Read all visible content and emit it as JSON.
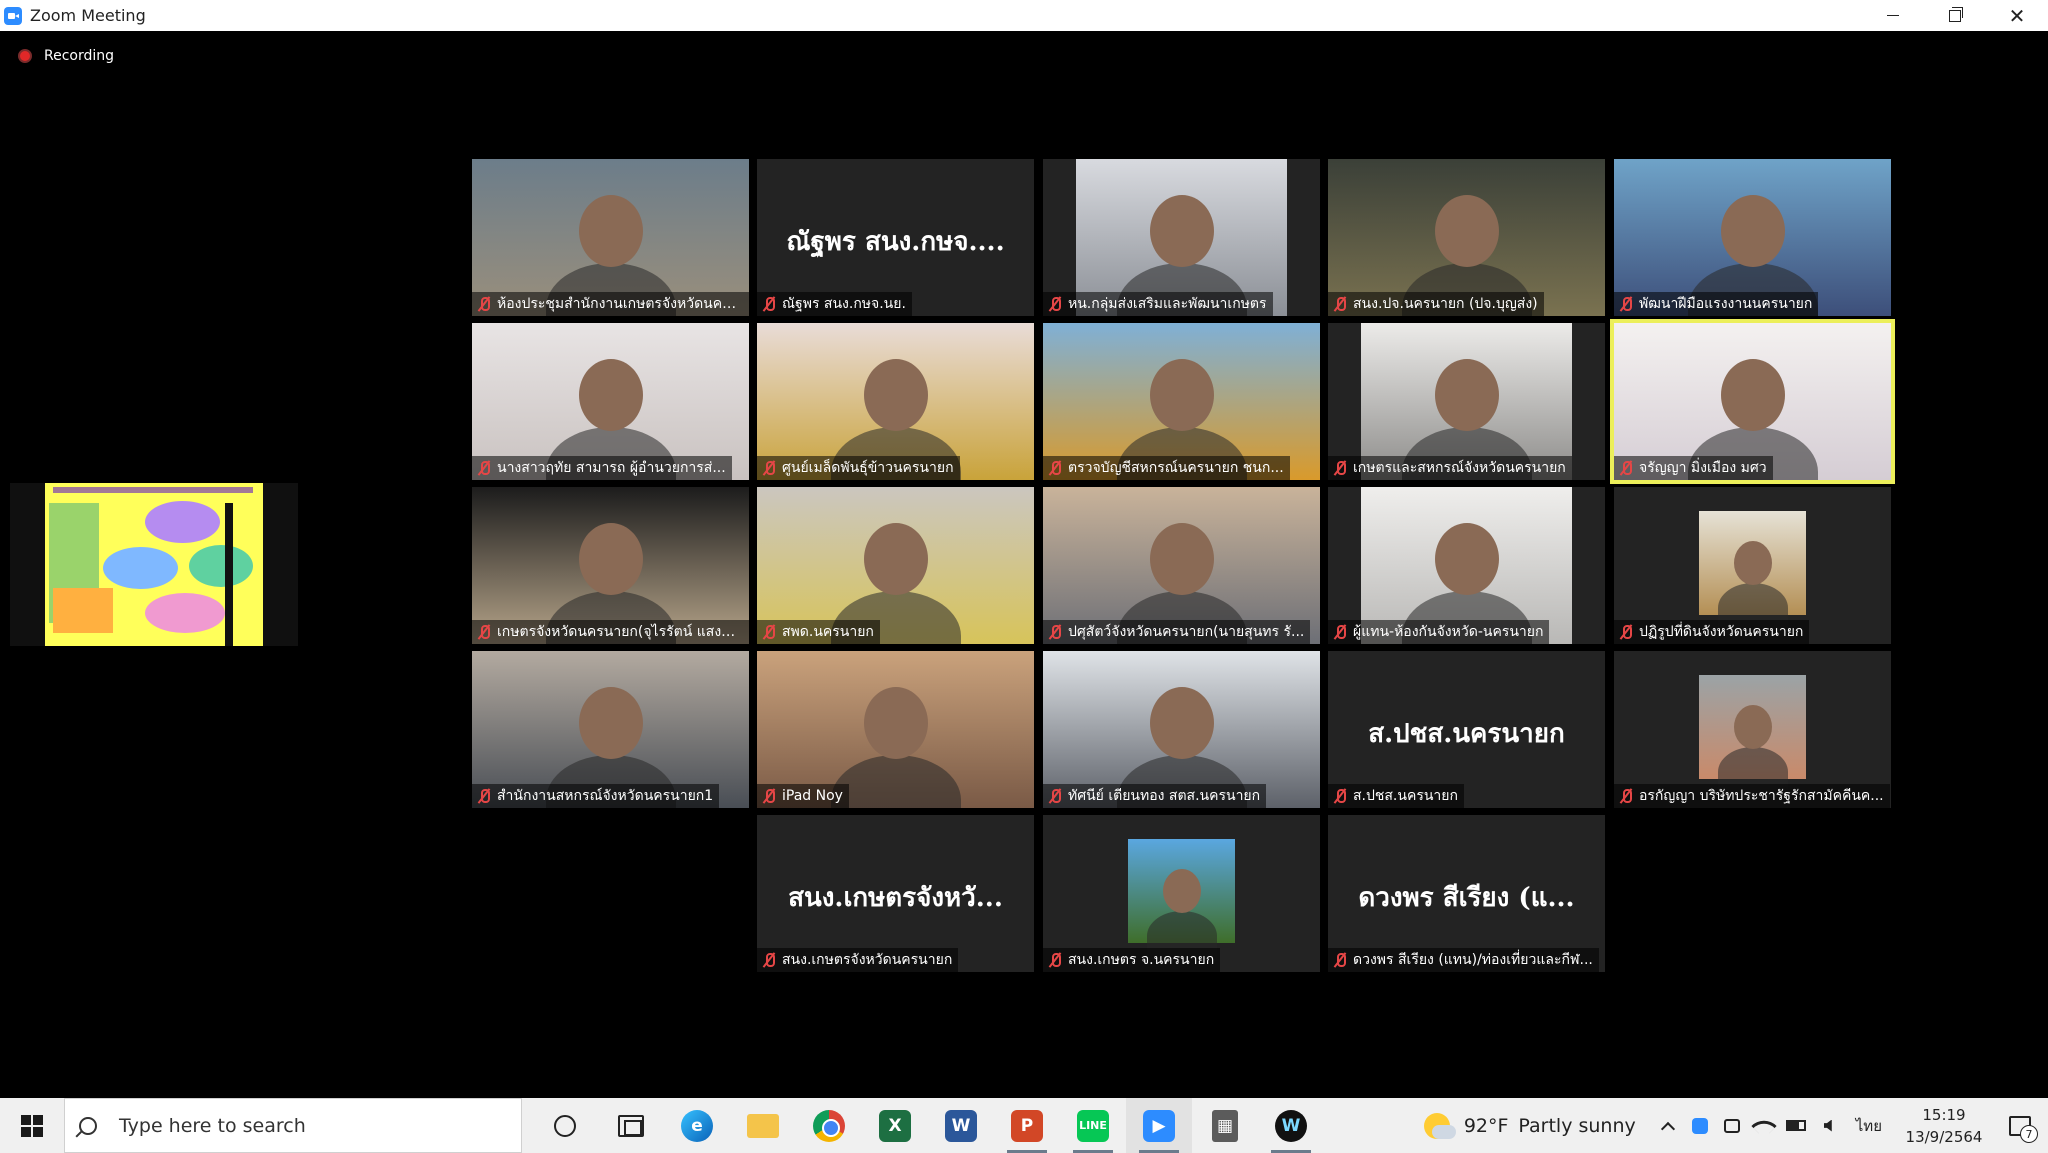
{
  "window": {
    "title": "Zoom Meeting"
  },
  "recording": {
    "label": "Recording"
  },
  "gallery": [
    {
      "label": "ห้องประชุมสำนักงานเกษตรจังหวัดนครนา...",
      "kind": "video",
      "bg": [
        "#6c7d8a",
        "#9a8f7c"
      ],
      "active": false
    },
    {
      "label": "ณัฐพร สนง.กษจ.นย.",
      "kind": "name",
      "name_text": "ณัฐพร สนง.กษจ....",
      "active": false
    },
    {
      "label": "หน.กลุ่มส่งเสริมและพัฒนาเกษตร",
      "kind": "video-inset",
      "bg": [
        "#d8dadf",
        "#8b8f96"
      ],
      "active": false
    },
    {
      "label": "สนง.ปจ.นครนายก (ปจ.บุญส่ง)",
      "kind": "video",
      "bg": [
        "#3b4038",
        "#7a7250"
      ],
      "active": false
    },
    {
      "label": "พัฒนาฝีมือแรงงานนครนายก",
      "kind": "video",
      "bg": [
        "#6fa3c8",
        "#3d4f7a"
      ],
      "active": false
    },
    {
      "label": "นางสาวฤทัย สามารถ ผู้อำนวยการส่...",
      "kind": "video",
      "bg": [
        "#e8e4e4",
        "#c9c2c0"
      ],
      "active": false
    },
    {
      "label": "ศูนย์เมล็ดพันธุ์ข้าวนครนายก",
      "kind": "video",
      "bg": [
        "#e9dcd8",
        "#c9a33a"
      ],
      "active": false
    },
    {
      "label": "ตรวจบัญชีสหกรณ์นครนายก ชนก...",
      "kind": "video",
      "bg": [
        "#7fb0d6",
        "#d99a2b"
      ],
      "active": false
    },
    {
      "label": "เกษตรและสหกรณ์จังหวัดนครนายก",
      "kind": "video-inset",
      "bg": [
        "#ecebe9",
        "#8d8c8a"
      ],
      "active": false
    },
    {
      "label": "จรัญญา มิ่งเมือง มศว",
      "kind": "video",
      "bg": [
        "#f4f1f0",
        "#d5cdd4"
      ],
      "active": true
    },
    {
      "label": "เกษตรจังหวัดนครนายก(จุไรรัตน์ แสงสวัส...",
      "kind": "video",
      "bg": [
        "#1c1c1c",
        "#b7a58a"
      ],
      "active": false
    },
    {
      "label": "สพด.นครนายก",
      "kind": "video",
      "bg": [
        "#cbc6bf",
        "#d7c45a"
      ],
      "active": false
    },
    {
      "label": "ปศุสัตว์จังหวัดนครนายก(นายสุนทร รั...",
      "kind": "video",
      "bg": [
        "#c9b39a",
        "#6d6f76"
      ],
      "active": false
    },
    {
      "label": "ผู้แทน-ห้องกันจังหวัด-นครนายก",
      "kind": "video-inset",
      "bg": [
        "#efeeec",
        "#b9b8b6"
      ],
      "active": false
    },
    {
      "label": "ปฏิรูปที่ดินจังหวัดนครนายก",
      "kind": "video-small",
      "bg": [
        "#e6e2d6",
        "#b48f54"
      ],
      "active": false
    },
    {
      "label": "สำนักงานสหกรณ์จังหวัดนครนายก1",
      "kind": "video",
      "bg": [
        "#b3aaa0",
        "#494e55"
      ],
      "active": false
    },
    {
      "label": "iPad Noy",
      "kind": "video",
      "bg": [
        "#caa27c",
        "#7a5a46"
      ],
      "active": false
    },
    {
      "label": "ทัศนีย์ เตียนทอง สตส.นครนายก",
      "kind": "video",
      "bg": [
        "#dfe3e7",
        "#5d6169"
      ],
      "active": false
    },
    {
      "label": "ส.ปชส.นครนายก",
      "kind": "name",
      "name_text": "ส.ปชส.นครนายก",
      "active": false
    },
    {
      "label": "อรกัญญา บริษัทประชารัฐรักสามัคคีนค...",
      "kind": "video-small",
      "bg": [
        "#9ba3a6",
        "#c98a6a"
      ],
      "active": false
    },
    {
      "label": "สนง.เกษตรจังหวัดนครนายก",
      "kind": "name",
      "name_text": "สนง.เกษตรจังหวั...",
      "active": false
    },
    {
      "label": "สนง.เกษตร จ.นครนายก",
      "kind": "video-small",
      "bg": [
        "#5aa7e0",
        "#3f6e2a"
      ],
      "active": false
    },
    {
      "label": "ดวงพร สีเรียง (แทน)/ท่องเที่ยวและกีฬ...",
      "kind": "name",
      "name_text": "ดวงพร สีเรียง (แ...",
      "active": false
    }
  ],
  "taskbar": {
    "search_placeholder": "Type here to search",
    "apps": [
      {
        "icon": "cortana-icon",
        "glyph": "",
        "open": false
      },
      {
        "icon": "task-view-icon",
        "glyph": "",
        "open": false
      },
      {
        "icon": "edge-icon",
        "glyph": "e",
        "open": false
      },
      {
        "icon": "file-explorer-icon",
        "glyph": "",
        "open": false
      },
      {
        "icon": "chrome-icon",
        "glyph": "",
        "open": false
      },
      {
        "icon": "excel-icon",
        "glyph": "X",
        "open": false
      },
      {
        "icon": "word-icon",
        "glyph": "W",
        "open": false
      },
      {
        "icon": "powerpoint-icon",
        "glyph": "P",
        "open": true
      },
      {
        "icon": "line-icon",
        "glyph": "LINE",
        "open": true
      },
      {
        "icon": "zoom-icon",
        "glyph": "▶",
        "open": true
      },
      {
        "icon": "calculator-icon",
        "glyph": "▦",
        "open": false
      },
      {
        "icon": "webex-icon",
        "glyph": "W",
        "open": true
      }
    ],
    "weather": {
      "temp": "92°F",
      "condition": "Partly sunny"
    },
    "language": "ไทย",
    "time": "15:19",
    "date": "13/9/2564",
    "notification_count": "7"
  }
}
